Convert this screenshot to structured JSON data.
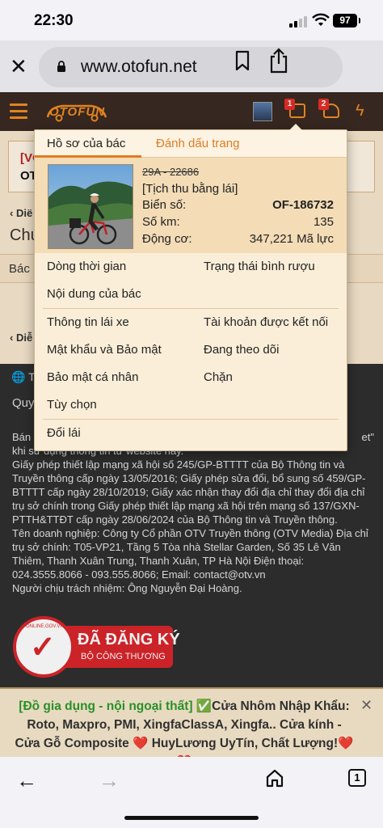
{
  "status_bar": {
    "time": "22:30",
    "battery": "97"
  },
  "browser": {
    "url": "www.otofun.net",
    "tab_count": "1"
  },
  "header": {
    "logo": "OTOFUN",
    "notifications": [
      {
        "name": "inbox",
        "count": "1"
      },
      {
        "name": "alerts",
        "count": "2"
      }
    ]
  },
  "background": {
    "alert_line1": "[VO",
    "alert_line2": "OT",
    "crumb1": "Dië",
    "title1": "Chú",
    "bar_label": "Bác",
    "crumb2": "Diễ"
  },
  "footer": {
    "lang": "T",
    "rules": "Quy",
    "p1_start": "Bán",
    "p1_end": "et\"",
    "p1_line2": "khi sử dụng thông tin từ website này.",
    "p2": "Giấy phép thiết lập mạng xã hội số 245/GP-BTTTT của Bộ Thông tin và Truyền thông cấp ngày 13/05/2016; Giấy phép sửa đổi, bổ sung số 459/GP-BTTTT cấp ngày 28/10/2019; Giấy xác nhận thay đổi địa chỉ thay đổi địa chỉ trụ sở chính trong Giấy phép thiết lập mạng xã hội trên mạng số 137/GXN-PTTH&TTĐT cấp ngày 28/06/2024 của Bộ Thông tin và Truyền thông.",
    "p3": "Tên doanh nghiệp: Công ty Cổ phần OTV Truyền thông (OTV Media) Địa chỉ trụ sở chính: T05-VP21, Tầng 5 Tòa nhà Stellar Garden, Số 35 Lê Văn Thiêm, Thanh Xuân Trung, Thanh Xuân, TP Hà Nội Điện thoại: 024.3555.8066 - 093.555.8066; Email: contact@otv.vn",
    "p4": "Người chịu trách nhiệm: Ông Nguyễn Đại Hoàng.",
    "seal_small": "ONLINE.GOV.VN",
    "seal_title": "ĐÃ ĐĂNG KÝ",
    "seal_sub": "BỘ CÔNG THƯƠNG"
  },
  "ad": {
    "green": "[Đồ gia dụng - nội ngoại thất]",
    "text": " ✅Cửa Nhôm Nhập Khẩu: Roto, Maxpro, PMI, XingfaClassA, Xingfa.. Cửa kính - Cửa Gỗ Composite ❤️ HuyLương UyTín, Chất Lượng!❤️❤️"
  },
  "dropdown": {
    "tabs": [
      "Hồ sơ của bác",
      "Đánh dấu trang"
    ],
    "profile": {
      "old_plate": "29A - 22686",
      "status": "[Tịch thu bằng lái]",
      "rows": [
        {
          "label": "Biển số:",
          "value": "OF-186732"
        },
        {
          "label": "Số km:",
          "value": "135"
        },
        {
          "label": "Động cơ:",
          "value": "347,221 Mã lực"
        }
      ]
    },
    "menu": {
      "timeline": "Dòng thời gian",
      "drunk_status": "Trạng thái bình rượu",
      "your_content": "Nội dung của bác",
      "driver_info": "Thông tin lái xe",
      "connected_accounts": "Tài khoản được kết nối",
      "password_security": "Mật khẩu và Bảo mật",
      "following": "Đang theo dõi",
      "privacy": "Bảo mật cá nhân",
      "blocked": "Chặn",
      "preferences": "Tùy chọn",
      "change_driver": "Đổi lái"
    }
  },
  "colors": {
    "accent": "#e07b22",
    "header_bg": "#3a2a22",
    "dropdown_bg": "#fbeed8"
  }
}
